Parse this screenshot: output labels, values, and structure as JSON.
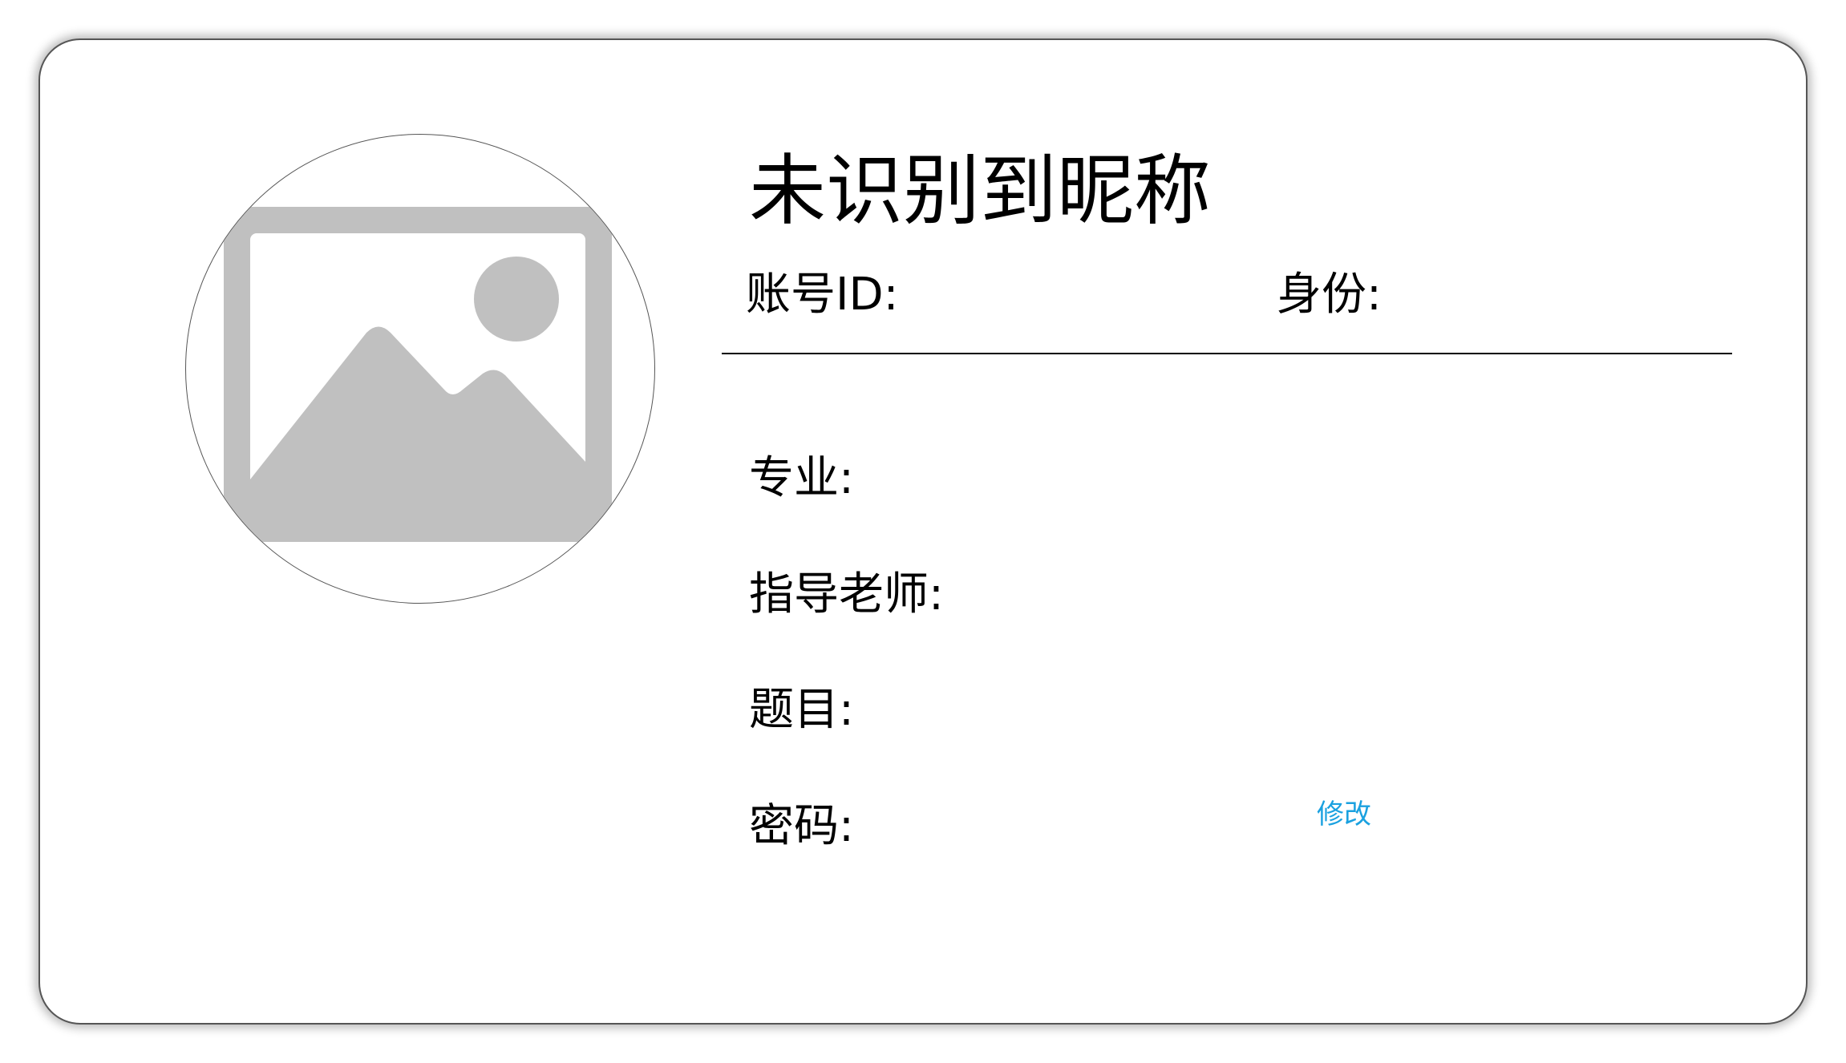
{
  "profile": {
    "nickname": "未识别到昵称",
    "account_id_label": "账号ID:",
    "role_label": "身份:",
    "avatar_icon": "image-placeholder-icon"
  },
  "fields": {
    "major_label": "专业:",
    "advisor_label": "指导老师:",
    "topic_label": "题目:",
    "password_label": "密码:"
  },
  "actions": {
    "edit_password_label": "修改"
  },
  "colors": {
    "link": "#1aa1e0",
    "placeholder": "#c0c0c0",
    "border": "#555555"
  }
}
